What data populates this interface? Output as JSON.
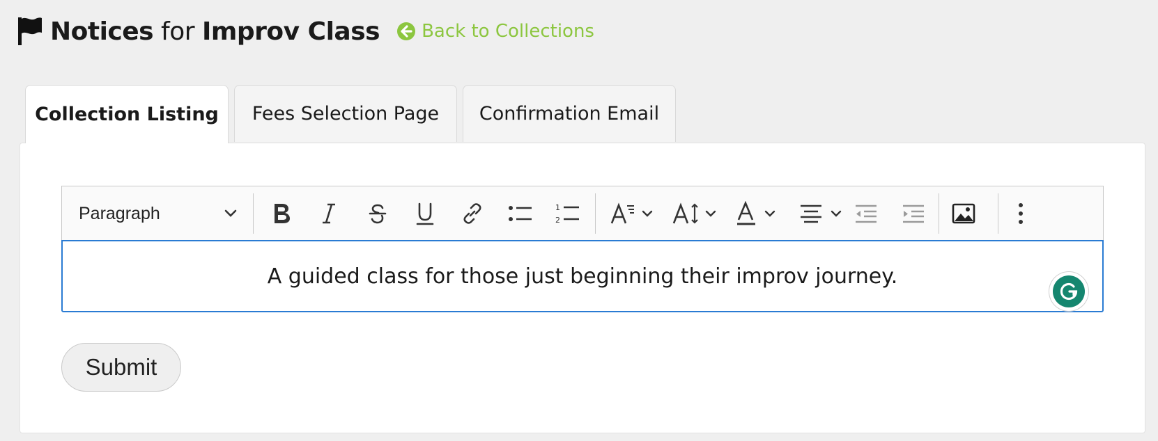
{
  "header": {
    "title_strong": "Notices",
    "title_mid": "for",
    "title_collection": "Improv Class",
    "back_link": "Back to Collections",
    "icons": {
      "flag": "flag-icon",
      "back": "arrow-circle-left-icon"
    },
    "accent_color": "#8cc63f"
  },
  "tabs": [
    {
      "label": "Collection Listing",
      "active": true
    },
    {
      "label": "Fees Selection Page",
      "active": false
    },
    {
      "label": "Confirmation Email",
      "active": false
    }
  ],
  "toolbar": {
    "block_format": "Paragraph",
    "buttons": [
      "bold-icon",
      "italic-icon",
      "strikethrough-icon",
      "underline-icon",
      "link-icon",
      "bulleted-list-icon",
      "numbered-list-icon",
      "font-family-icon",
      "font-size-icon",
      "font-color-icon",
      "align-center-icon",
      "outdent-icon",
      "indent-icon",
      "image-icon",
      "more-vertical-icon"
    ]
  },
  "editor": {
    "content": "A guided class for those just beginning their improv journey.",
    "focus_color": "#2a7bd3"
  },
  "grammarly": {
    "icon": "grammarly-icon",
    "color": "#15866f"
  },
  "form": {
    "submit_label": "Submit"
  }
}
